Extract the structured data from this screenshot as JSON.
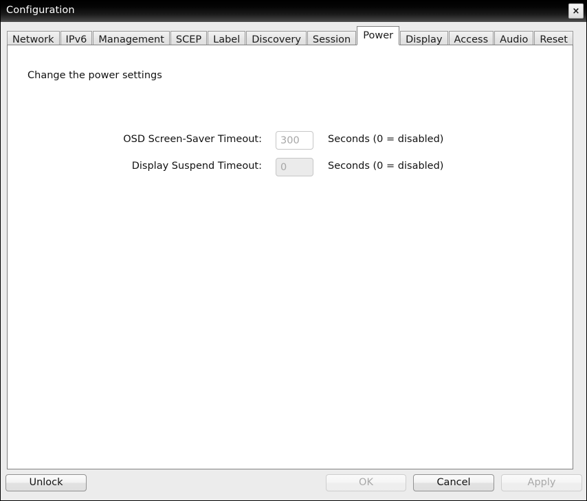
{
  "window": {
    "title": "Configuration",
    "close_icon": "close-icon",
    "close_label": "×"
  },
  "tabs": [
    {
      "label": "Network",
      "active": false
    },
    {
      "label": "IPv6",
      "active": false
    },
    {
      "label": "Management",
      "active": false
    },
    {
      "label": "SCEP",
      "active": false
    },
    {
      "label": "Label",
      "active": false
    },
    {
      "label": "Discovery",
      "active": false
    },
    {
      "label": "Session",
      "active": false
    },
    {
      "label": "Power",
      "active": true
    },
    {
      "label": "Display",
      "active": false
    },
    {
      "label": "Access",
      "active": false
    },
    {
      "label": "Audio",
      "active": false
    },
    {
      "label": "Reset",
      "active": false
    }
  ],
  "panel": {
    "heading": "Change the power settings",
    "fields": [
      {
        "label": "OSD Screen-Saver Timeout:",
        "value": "300",
        "hint": "Seconds (0 = disabled)",
        "disabled": true,
        "filled": false
      },
      {
        "label": "Display Suspend Timeout:",
        "value": "0",
        "hint": "Seconds (0 = disabled)",
        "disabled": true,
        "filled": true
      }
    ]
  },
  "buttons": {
    "unlock": {
      "label": "Unlock",
      "disabled": false
    },
    "ok": {
      "label": "OK",
      "disabled": true
    },
    "cancel": {
      "label": "Cancel",
      "disabled": false
    },
    "apply": {
      "label": "Apply",
      "disabled": true
    }
  },
  "colors": {
    "titlebar_top": "#000000",
    "titlebar_bottom": "#4f4f4f",
    "chrome": "#ececec",
    "panel": "#ffffff",
    "border": "#808080",
    "disabled_text": "#a8a8a8"
  }
}
